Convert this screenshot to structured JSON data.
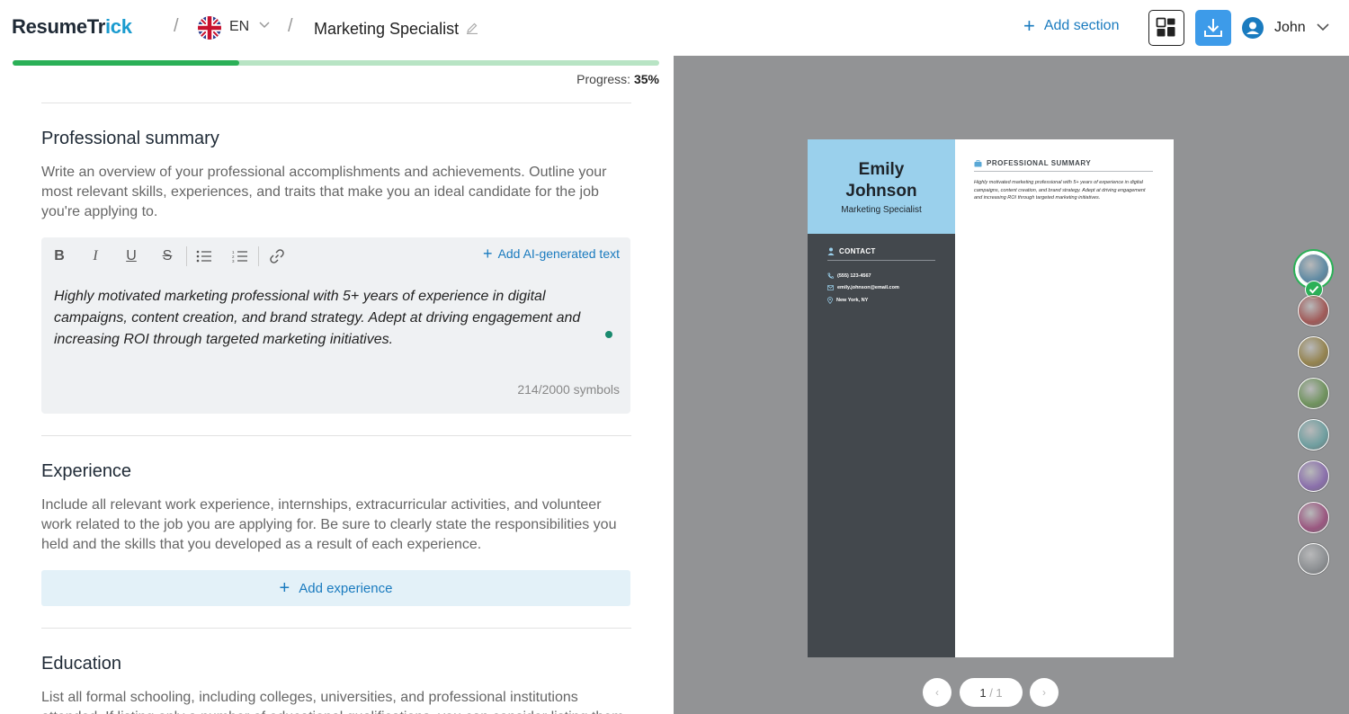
{
  "header": {
    "logo_main": "ResumeTr",
    "logo_accent": "ick",
    "separator": "/",
    "language": "EN",
    "doc_title": "Marketing Specialist",
    "add_section_label": "Add section",
    "user_name": "John"
  },
  "progress": {
    "label": "Progress:",
    "value_text": "35%",
    "fraction": 0.35
  },
  "sections": {
    "summary": {
      "title": "Professional summary",
      "description": "Write an overview of your professional accomplishments and achievements. Outline your most relevant skills, experiences, and traits that make you an ideal candidate for the job you're applying to.",
      "ai_link": "Add AI-generated text",
      "text": "Highly motivated marketing professional with 5+ years of experience in digital campaigns, content creation, and brand strategy. Adept at driving engagement and increasing ROI through targeted marketing initiatives.",
      "counter": "214/2000 symbols"
    },
    "experience": {
      "title": "Experience",
      "description": "Include all relevant work experience, internships, extracurricular activities, and volunteer work related to the job you are applying for. Be sure to clearly state the responsibilities you held and the skills that you developed as a result of each experience.",
      "add_label": "Add experience"
    },
    "education": {
      "title": "Education",
      "description": "List all formal schooling, including colleges, universities, and professional institutions attended. If listing only a number of educational qualifications, you can consider listing them in"
    }
  },
  "toolbar": {
    "bold": "B",
    "italic": "I",
    "underline": "U",
    "strike": "S"
  },
  "resume": {
    "first_name": "Emily",
    "last_name": "Johnson",
    "role": "Marketing Specialist",
    "contact_heading": "CONTACT",
    "phone": "(555) 123-4567",
    "email": "emily.johnson@email.com",
    "location": "New York, NY",
    "summary_heading": "PROFESSIONAL SUMMARY",
    "summary_text": "Highly motivated marketing professional with 5+ years of experience in digital campaigns, content creation, and brand strategy. Adept at driving engagement and increasing ROI through targeted marketing initiatives."
  },
  "pager": {
    "current": "1",
    "total": "/ 1",
    "prev": "‹",
    "next": "›"
  },
  "colors": {
    "accent": "#1a7bbf",
    "progress": "#2bb057",
    "resume_header": "#9ad0ec",
    "resume_sidebar": "#43484d",
    "swatches": [
      "#5f8aa3",
      "#a05a58",
      "#94834f",
      "#6f925d",
      "#6f9e9f",
      "#8a6fab",
      "#9a5780",
      "#8c8f92"
    ],
    "selected_swatch_index": 0
  }
}
